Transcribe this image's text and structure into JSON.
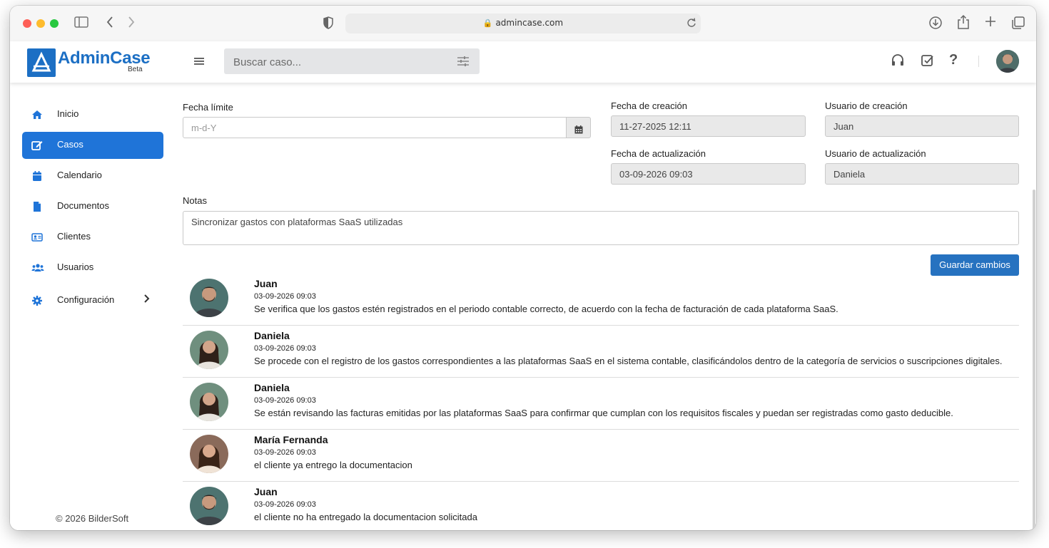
{
  "browser": {
    "url": "admincase.com"
  },
  "app": {
    "logo": "AdminCase",
    "logo_sub": "Beta",
    "search_placeholder": "Buscar caso..."
  },
  "sidebar": {
    "items": [
      {
        "label": "Inicio",
        "icon": "home-icon"
      },
      {
        "label": "Casos",
        "icon": "edit-icon",
        "active": true
      },
      {
        "label": "Calendario",
        "icon": "calendar-icon"
      },
      {
        "label": "Documentos",
        "icon": "file-icon"
      },
      {
        "label": "Clientes",
        "icon": "id-card-icon"
      },
      {
        "label": "Usuarios",
        "icon": "users-icon"
      },
      {
        "label": "Configuración",
        "icon": "gear-icon"
      }
    ],
    "copyright": "© 2026 BilderSoft"
  },
  "form": {
    "fecha_limite_label": "Fecha límite",
    "fecha_limite_placeholder": "m-d-Y",
    "fecha_creacion_label": "Fecha de creación",
    "fecha_creacion_value": "11-27-2025 12:11",
    "usuario_creacion_label": "Usuario de creación",
    "usuario_creacion_value": "Juan",
    "fecha_actualizacion_label": "Fecha de actualización",
    "fecha_actualizacion_value": "03-09-2026 09:03",
    "usuario_actualizacion_label": "Usuario de actualización",
    "usuario_actualizacion_value": "Daniela",
    "notas_label": "Notas",
    "notas_value": "Sincronizar gastos con plataformas SaaS utilizadas",
    "save_label": "Guardar cambios"
  },
  "comments": [
    {
      "name": "Juan",
      "date": "03-09-2026 09:03",
      "text": "Se verifica que los gastos estén registrados en el periodo contable correcto, de acuerdo con la fecha de facturación de cada plataforma SaaS."
    },
    {
      "name": "Daniela",
      "date": "03-09-2026 09:03",
      "text": "Se procede con el registro de los gastos correspondientes a las plataformas SaaS en el sistema contable, clasificándolos dentro de la categoría de servicios o suscripciones digitales."
    },
    {
      "name": "Daniela",
      "date": "03-09-2026 09:03",
      "text": "Se están revisando las facturas emitidas por las plataformas SaaS para confirmar que cumplan con los requisitos fiscales y puedan ser registradas como gasto deducible."
    },
    {
      "name": "María Fernanda",
      "date": "03-09-2026 09:03",
      "text": "el cliente ya entrego la documentacion"
    },
    {
      "name": "Juan",
      "date": "03-09-2026 09:03",
      "text": "el cliente no ha entregado la documentacion solicitada"
    }
  ],
  "colors": {
    "primary": "#1f74d8",
    "brand": "#1c6fc4",
    "button": "#2672c0"
  }
}
